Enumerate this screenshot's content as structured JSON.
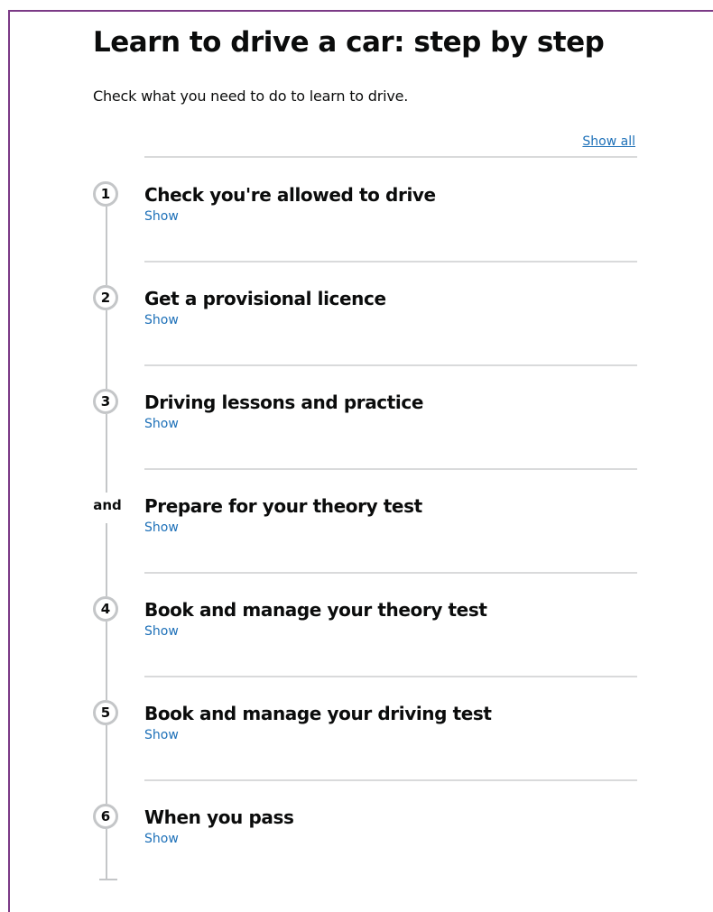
{
  "page": {
    "title": "Learn to drive a car: step by step",
    "lede": "Check what you need to do to learn to drive.",
    "show_all_label": "Show all"
  },
  "steps": [
    {
      "marker": "1",
      "title": "Check you're allowed to drive",
      "toggle_label": "Show"
    },
    {
      "marker": "2",
      "title": "Get a provisional licence",
      "toggle_label": "Show"
    },
    {
      "marker": "3",
      "title": "Driving lessons and practice",
      "toggle_label": "Show"
    },
    {
      "marker": "and",
      "title": "Prepare for your theory test",
      "toggle_label": "Show"
    },
    {
      "marker": "4",
      "title": "Book and manage your theory test",
      "toggle_label": "Show"
    },
    {
      "marker": "5",
      "title": "Book and manage your driving test",
      "toggle_label": "Show"
    },
    {
      "marker": "6",
      "title": "When you pass",
      "toggle_label": "Show"
    }
  ],
  "colors": {
    "link": "#1d70b8",
    "text": "#0b0c0c",
    "rule": "#d9dadb",
    "step_line": "#c4c6c8",
    "frame": "#7b3a86"
  }
}
